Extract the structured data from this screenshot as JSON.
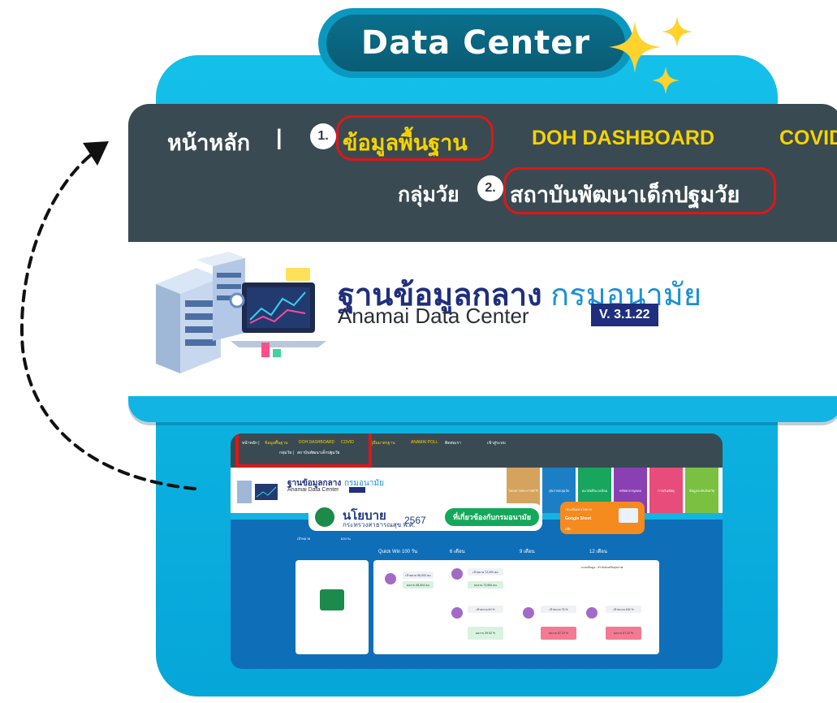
{
  "header_badge": {
    "title": "Data Center"
  },
  "nav": {
    "home": "หน้าหลัก",
    "separator": "|",
    "step1": "1.",
    "basic_data": "ข้อมูลพื้นฐาน",
    "doh_dashboard": "DOH DASHBOARD",
    "covid": "COVID",
    "age_group": "กลุ่มวัย",
    "step2": "2.",
    "early_child": "สถาบันพัฒนาเด็กปฐมวัย"
  },
  "brand": {
    "title_th": "ฐานข้อมูลกลาง",
    "title_th_accent": "กรมอนามัย",
    "title_en": "Anamai Data Center",
    "version": "V. 3.1.22"
  },
  "mini_page": {
    "nav_home": "หน้าหลัก |",
    "nav_basic": "ข้อมูลพื้นฐาน",
    "nav_doh": "DOH DASHBOARD",
    "nav_covid": "COVID",
    "nav_std": "คู่มือมาตรฐาน",
    "nav_poll": "ANAMAI POLL",
    "nav_contact": "ติดต่อเรา",
    "nav_login": "เข้าสู่ระบบ",
    "nav_age": "กลุ่มวัย |",
    "nav_early": "สถาบันพัฒนาเด็กปฐมวัย",
    "brand_th": "ฐานข้อมูลกลาง",
    "brand_accent": "กรมอนามัย",
    "brand_en": "Anamai Data Center",
    "tiles": [
      "โครงการพระราชดำริ",
      "สุขภาพกลุ่มวัย",
      "อนามัยสิ่งแวดล้อม",
      "ทรัพยากรบุคคล",
      "การเงินพัสดุ",
      "ข้อมูลระดับจังหวัด"
    ],
    "policy_big": "นโยบาย",
    "policy_sub": "กระทรวงสาธารณสุข พ.ศ.",
    "policy_year": "2567",
    "policy_btn": "ที่เกี่ยวข้องกับกรมอนามัย",
    "orange_a": "ประเมินผลนโยบาย",
    "orange_b": "Google Sheet",
    "orange_c": "คลิก",
    "legend_a": "เป้าหมาย",
    "legend_b": "ผลงาน",
    "quickwin": "Quick Win 100 วัน",
    "m6": "6 เดือน",
    "m9": "9 เดือน",
    "m12": "12 เดือน",
    "goal_1": "เป้าหมาย 56,000 คน",
    "result_1": "ผลงาน 68,304 คน",
    "goal_2": "เป้าหมาย 72,000 คน",
    "result_2": "ผลงาน 72,954 คน",
    "goal_3": "เป้าหมาย 40 %",
    "result_3": "ผลงาน 39.92 %",
    "goal_4": "เป้าหมาย 75 %",
    "result_4": "ผลงาน 67.22 %",
    "goal_5": "เป้าหมาย 100 %",
    "result_5": "ผลงาน 67.22 %",
    "source": "แหล่งข้อมูล : สำนักส่งเสริมสุขภาพ"
  }
}
